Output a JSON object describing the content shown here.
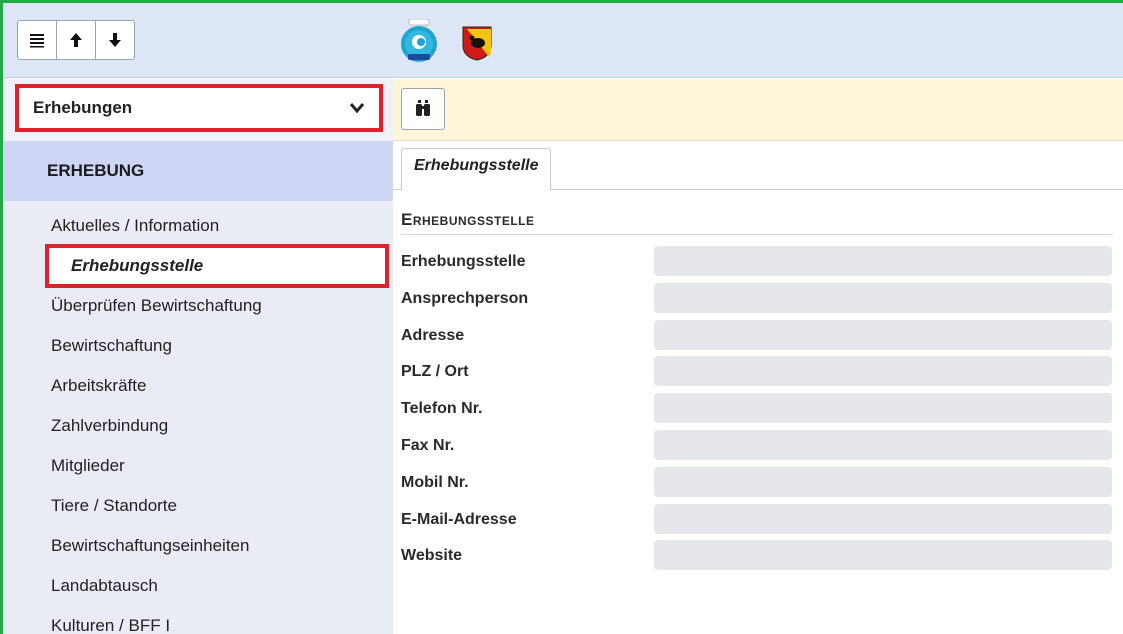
{
  "toolbar": {
    "buttons": [
      {
        "icon": "list-icon"
      },
      {
        "icon": "arrow-up-icon"
      },
      {
        "icon": "arrow-down-icon"
      }
    ],
    "search_icon": "binoculars-icon"
  },
  "logos": {
    "gelan": "GELAN"
  },
  "dropdown": {
    "selected": "Erhebungen"
  },
  "sidebar": {
    "section": "ERHEBUNG",
    "items": [
      "Aktuelles / Information",
      "Erhebungsstelle",
      "Überprüfen Bewirtschaftung",
      "Bewirtschaftung",
      "Arbeitskräfte",
      "Zahlverbindung",
      "Mitglieder",
      "Tiere / Standorte",
      "Bewirtschaftungseinheiten",
      "Landabtausch",
      "Kulturen / BFF I"
    ],
    "active_index": 1
  },
  "content": {
    "tab": "Erhebungsstelle",
    "group_title": "Erhebungsstelle",
    "fields": [
      {
        "label": "Erhebungsstelle",
        "value": ""
      },
      {
        "label": "Ansprechperson",
        "value": ""
      },
      {
        "label": "Adresse",
        "value": ""
      },
      {
        "label": "PLZ / Ort",
        "value": ""
      },
      {
        "label": "Telefon Nr.",
        "value": ""
      },
      {
        "label": "Fax Nr.",
        "value": ""
      },
      {
        "label": "Mobil Nr.",
        "value": ""
      },
      {
        "label": "E-Mail-Adresse",
        "value": ""
      },
      {
        "label": "Website",
        "value": ""
      }
    ]
  },
  "colors": {
    "highlight": "#e0202a",
    "frame": "#22aa44",
    "topbar": "#dde6f4",
    "toolbar": "#fdf6d8",
    "section": "#ced6f5"
  }
}
